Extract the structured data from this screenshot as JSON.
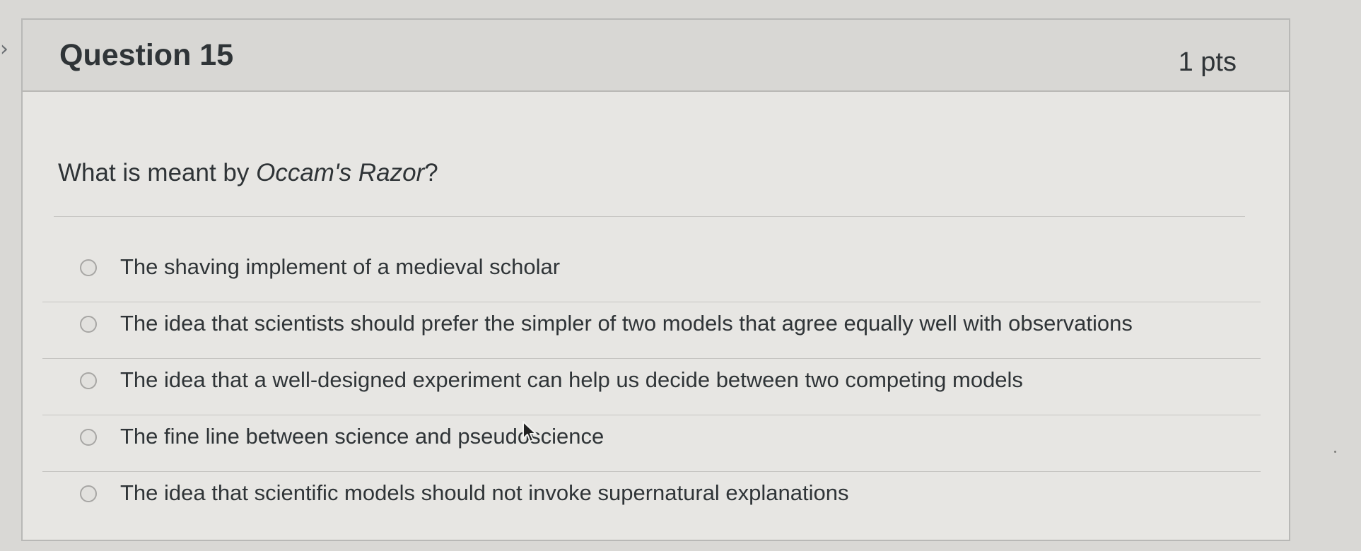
{
  "icons": {
    "left_chevron": "chevron-right-icon",
    "radio": "radio-button-icon",
    "cursor": "mouse-pointer-icon"
  },
  "colors": {
    "page_background": "#d9d8d5",
    "card_background": "#e7e6e3",
    "header_background": "#d8d7d4",
    "text": "#2f3437",
    "border": "#b8b8b6"
  },
  "question": {
    "title": "Question 15",
    "points": "1 pts",
    "prompt_before": "What is meant by ",
    "prompt_italic": "Occam's Razor",
    "prompt_after": "?"
  },
  "answers": [
    {
      "label": "The shaving implement of a medieval scholar",
      "selected": false
    },
    {
      "label": "The idea that scientists should prefer the simpler of two models that agree equally well with observations",
      "selected": false
    },
    {
      "label": "The idea that a well-designed experiment can help us decide between two competing models",
      "selected": false
    },
    {
      "label": "The fine line between science and pseudoscience",
      "selected": false
    },
    {
      "label": "The idea that scientific models should not invoke supernatural explanations",
      "selected": false
    }
  ]
}
